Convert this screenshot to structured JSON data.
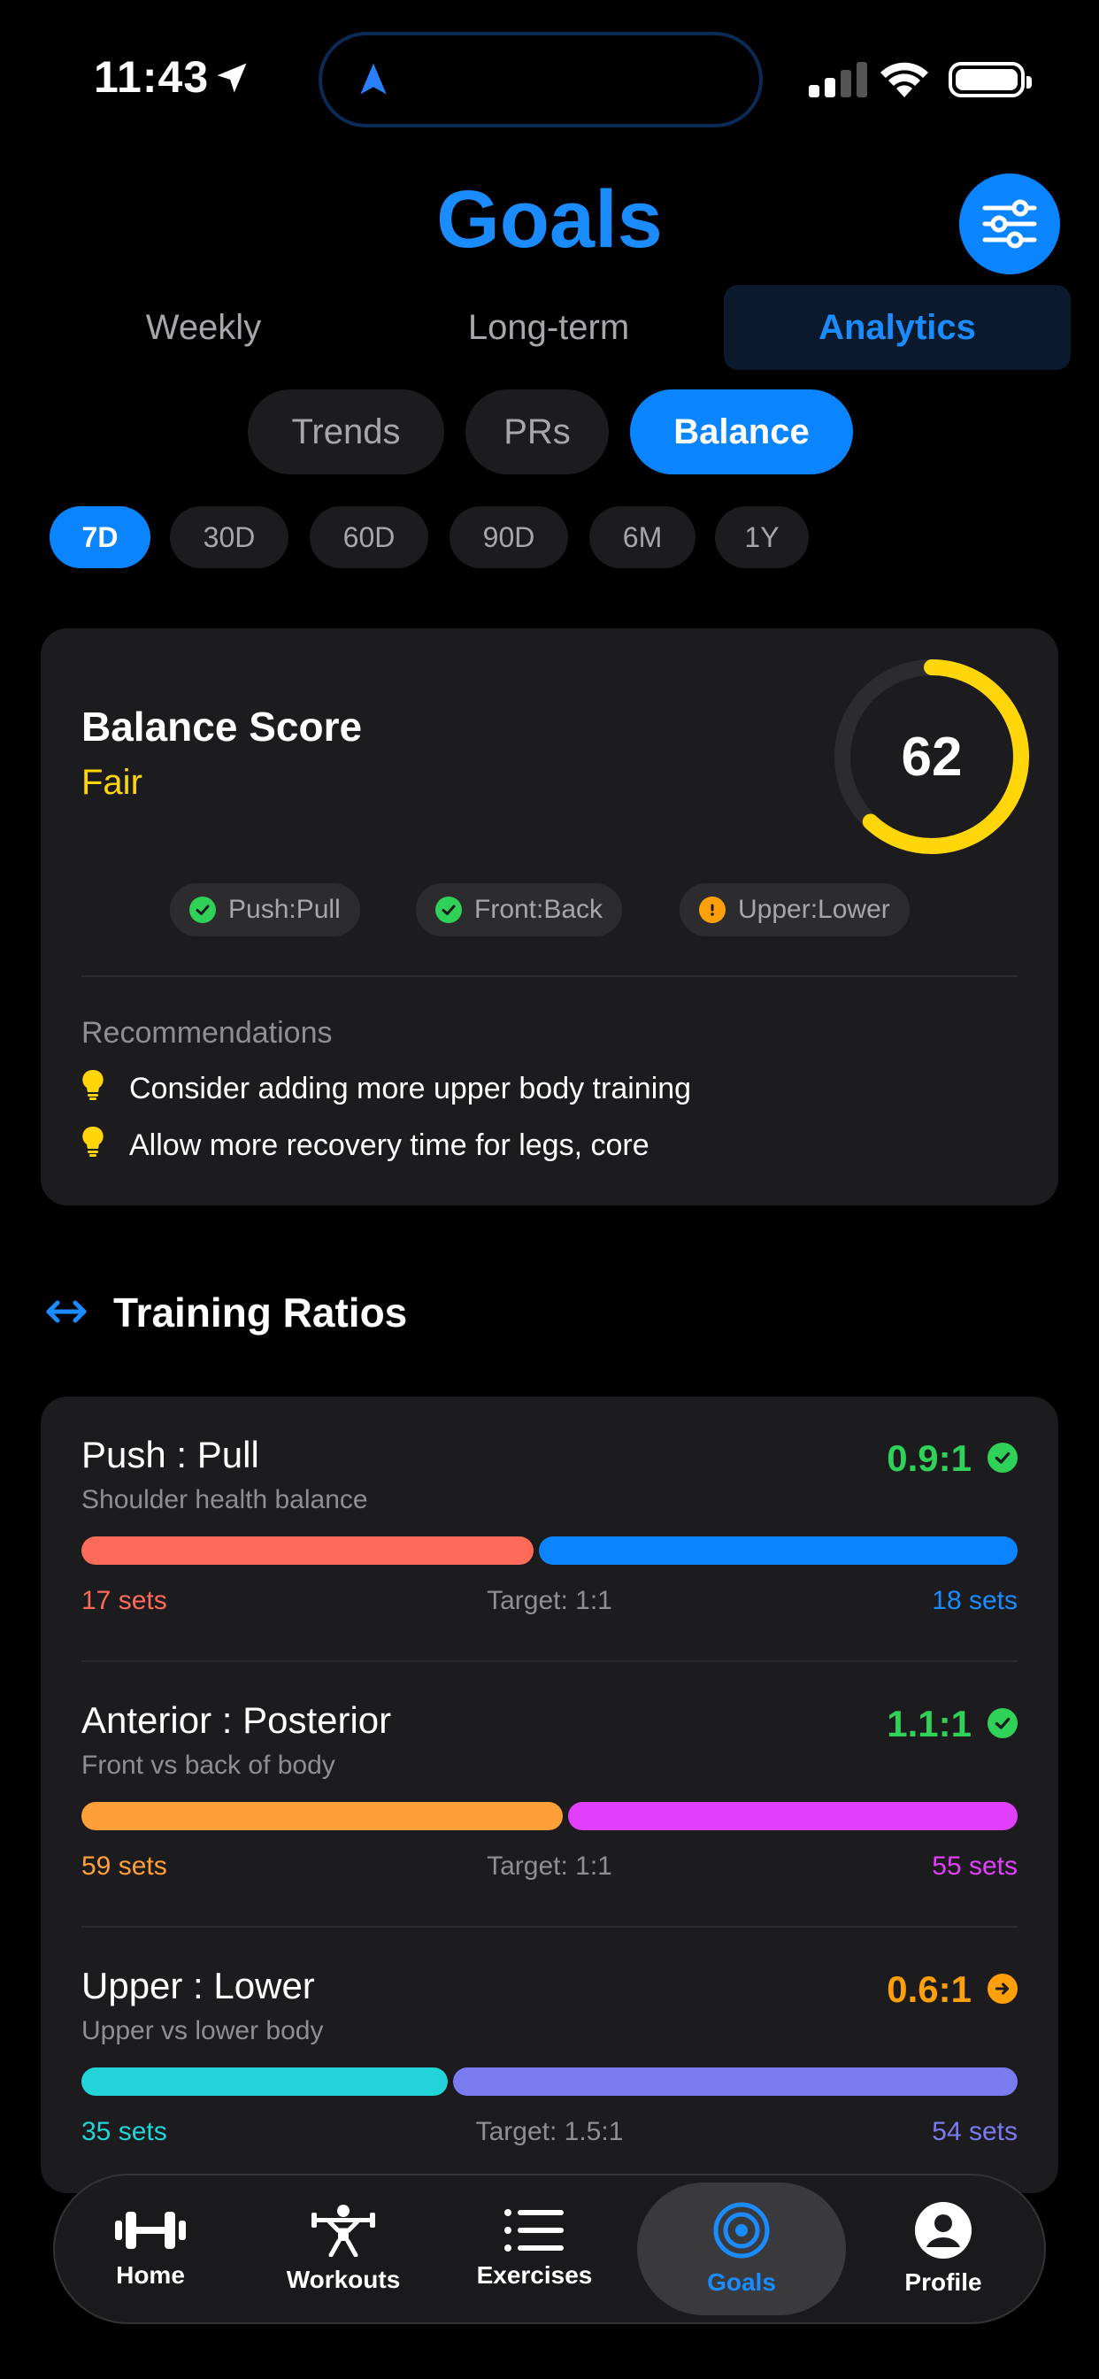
{
  "status_bar": {
    "time": "11:43"
  },
  "header": {
    "title": "Goals"
  },
  "top_tabs": [
    {
      "label": "Weekly"
    },
    {
      "label": "Long-term"
    },
    {
      "label": "Analytics"
    }
  ],
  "sub_tabs": [
    {
      "label": "Trends"
    },
    {
      "label": "PRs"
    },
    {
      "label": "Balance"
    }
  ],
  "ranges": [
    "7D",
    "30D",
    "60D",
    "90D",
    "6M",
    "1Y"
  ],
  "balance": {
    "title": "Balance Score",
    "rating": "Fair",
    "score": "62",
    "score_fraction": 0.62,
    "checks": [
      {
        "label": "Push:Pull",
        "status": "ok"
      },
      {
        "label": "Front:Back",
        "status": "ok"
      },
      {
        "label": "Upper:Lower",
        "status": "warning"
      }
    ],
    "recommendations_title": "Recommendations",
    "recommendations": [
      "Consider adding more upper body training",
      "Allow more recovery time for legs, core"
    ]
  },
  "training_ratios": {
    "title": "Training Ratios",
    "rows": [
      {
        "name": "Push : Pull",
        "desc": "Shoulder health balance",
        "value": "0.9:1",
        "left": "17 sets",
        "target": "Target: 1:1",
        "right": "18 sets",
        "left_sets": 17,
        "right_sets": 18,
        "status": "ok"
      },
      {
        "name": "Anterior : Posterior",
        "desc": "Front vs back of body",
        "value": "1.1:1",
        "left": "59 sets",
        "target": "Target: 1:1",
        "right": "55 sets",
        "left_sets": 59,
        "right_sets": 55,
        "status": "ok"
      },
      {
        "name": "Upper : Lower",
        "desc": "Upper vs lower body",
        "value": "0.6:1",
        "left": "35 sets",
        "target": "Target: 1.5:1",
        "right": "54 sets",
        "left_sets": 35,
        "right_sets": 54,
        "status": "warning"
      }
    ]
  },
  "colors": {
    "accent": "#0a84ff",
    "ok": "#30d158",
    "warning": "#ff9f0a",
    "fair": "#ffd60a",
    "push": "#ff6b5b",
    "pull": "#0a84ff",
    "anterior": "#ff9f3a",
    "posterior": "#e040fb",
    "upper": "#22d3d8",
    "lower": "#7b7bf0"
  },
  "nav": [
    {
      "label": "Home",
      "icon": "dumbbell-icon"
    },
    {
      "label": "Workouts",
      "icon": "weightlifter-icon"
    },
    {
      "label": "Exercises",
      "icon": "list-icon"
    },
    {
      "label": "Goals",
      "icon": "target-icon"
    },
    {
      "label": "Profile",
      "icon": "person-icon"
    }
  ]
}
